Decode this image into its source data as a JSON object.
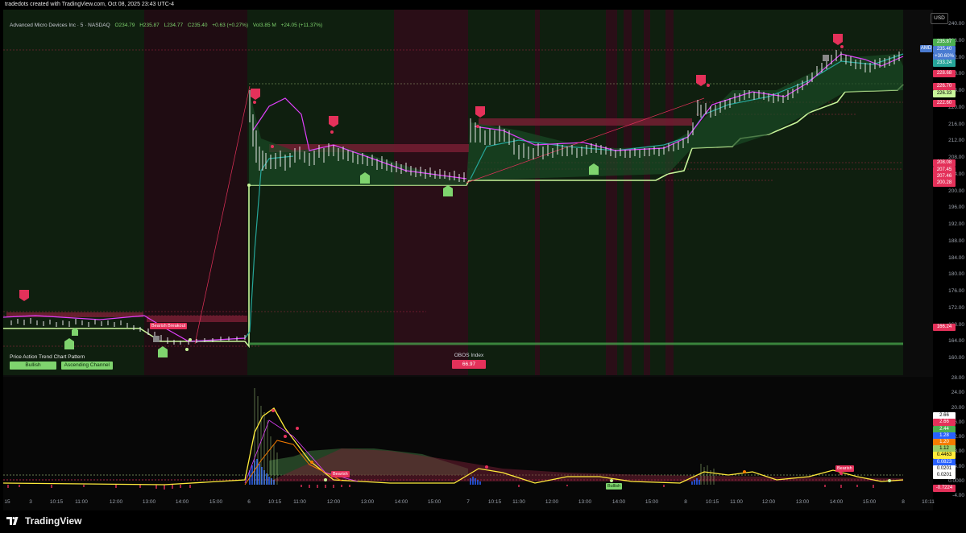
{
  "caption": "tradedots created with TradingView.com, Oct 08, 2025 23:43 UTC-4",
  "legend": {
    "symbol": "Advanced Micro Devices Inc · 5 · NASDAQ",
    "open": "O234.79",
    "high": "H235.87",
    "low": "L234.77",
    "close": "C235.40",
    "change": "+0.63 (+0.27%)",
    "vol": "Vol3.85 M",
    "vol_change": "+24.05 (+11.37%)"
  },
  "currency": "USD",
  "price_axis": [
    "240.00",
    "236.00",
    "232.00",
    "228.00",
    "224.00",
    "220.00",
    "216.00",
    "212.00",
    "208.00",
    "204.00",
    "200.00",
    "196.00",
    "192.00",
    "188.00",
    "184.00",
    "180.00",
    "176.00",
    "172.00",
    "168.00",
    "164.00",
    "160.00"
  ],
  "indicator_axis": [
    "28.00",
    "24.00",
    "20.00",
    "16.00",
    "12.00",
    "8.00",
    "4.00",
    "0.0000",
    "-4.00"
  ],
  "price_tags": [
    {
      "text": "235.87",
      "color": "#4caf50"
    },
    {
      "text": "235.40",
      "color": "#4a7bd1"
    },
    {
      "text": "+30.60%",
      "color": "#4a7bd1"
    },
    {
      "text": "233.24",
      "color": "#26a69a"
    },
    {
      "text": "228.68",
      "color": "#e4315a"
    },
    {
      "text": "226.70",
      "color": "#e4315a"
    },
    {
      "text": "226.33",
      "color": "#c8f59a"
    },
    {
      "text": "222.60",
      "color": "#e4315a"
    },
    {
      "text": "208.08",
      "color": "#e4315a"
    },
    {
      "text": "207.45",
      "color": "#e4315a"
    },
    {
      "text": "207.46",
      "color": "#e4315a"
    },
    {
      "text": "200.28",
      "color": "#e4315a"
    },
    {
      "text": "166.24",
      "color": "#e4315a"
    }
  ],
  "amd_tag": "AMD",
  "indicator_tags": [
    {
      "text": "2.66",
      "color": "#ffffff",
      "fg": "#000"
    },
    {
      "text": "2.66",
      "color": "#e4315a",
      "fg": "#fff"
    },
    {
      "text": "2.44",
      "color": "#4caf50",
      "fg": "#fff"
    },
    {
      "text": "1.28",
      "color": "#2962ff",
      "fg": "#fff"
    },
    {
      "text": "1.20",
      "color": "#f57c00",
      "fg": "#fff"
    },
    {
      "text": "1.12",
      "color": "#9ccc65",
      "fg": "#000"
    },
    {
      "text": "0.4463",
      "color": "#ffeb3b",
      "fg": "#000"
    },
    {
      "text": "0.0823",
      "color": "#2962ff",
      "fg": "#fff"
    },
    {
      "text": "0.0201",
      "color": "#ffffff",
      "fg": "#000"
    },
    {
      "text": "0.0201",
      "color": "#ffffff",
      "fg": "#000"
    },
    {
      "text": "-0.7224",
      "color": "#e4315a",
      "fg": "#fff"
    }
  ],
  "time_axis": [
    "15",
    "3",
    "10:15",
    "11:00",
    "12:00",
    "13:00",
    "14:00",
    "15:00",
    "6",
    "10:15",
    "11:00",
    "12:00",
    "13:00",
    "14:00",
    "15:00",
    "7",
    "10:15",
    "11:00",
    "12:00",
    "13:00",
    "14:00",
    "15:00",
    "8",
    "10:15",
    "11:00",
    "12:00",
    "13:00",
    "14:00",
    "15:00",
    "8",
    "10:11"
  ],
  "pa_table": {
    "header1": "Price Action Trend",
    "header2": "Chart Pattern",
    "val1": "Bullish",
    "val2": "Ascending Channel"
  },
  "obos": {
    "label": "OBOS Index",
    "value": "66.97"
  },
  "labels": {
    "bearish_breakout": "Bearish Breakout",
    "bearish_1": "Bearish",
    "bearish_2": "Bearish",
    "bullish": "Bullish"
  },
  "brand": "TradingView",
  "colors": {
    "bull": "#7fd46e",
    "bear": "#e4315a",
    "teal": "#26a69a",
    "magenta": "#e040fb",
    "lime": "#c8f59a"
  }
}
